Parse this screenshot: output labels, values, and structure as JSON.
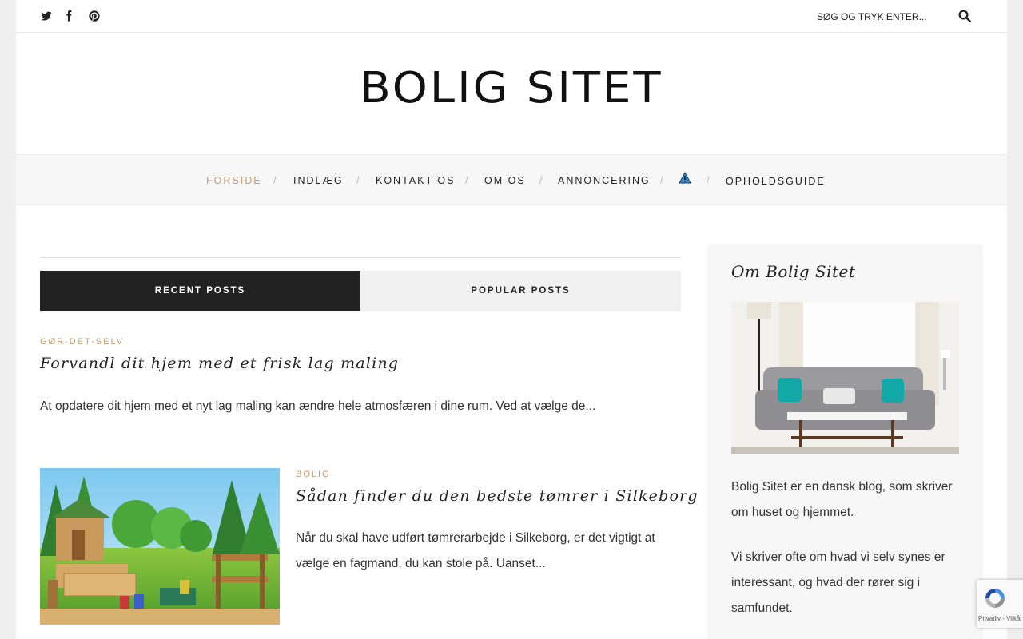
{
  "topbar": {
    "social_icons": [
      "twitter-icon",
      "facebook-icon",
      "pinterest-icon"
    ],
    "search_placeholder": "SØG OG TRYK ENTER..."
  },
  "site": {
    "logo": "BOLIG SITET"
  },
  "nav": {
    "items": [
      "FORSIDE",
      "INDLÆG",
      "KONTAKT OS",
      "OM OS",
      "ANNONCERING",
      "",
      "OPHOLDSGUIDE"
    ],
    "separator": "/",
    "active_color": "#c69c6d"
  },
  "tabs": {
    "recent": "RECENT POSTS",
    "popular": "POPULAR POSTS"
  },
  "posts": [
    {
      "category": "GØR-DET-SELV",
      "title": "Forvandl dit hjem med et frisk lag maling",
      "excerpt": "At opdatere dit hjem med et nyt lag maling kan ændre hele atmosfæren i dine rum. Ved at vælge de..."
    },
    {
      "category": "BOLIG",
      "title": "Sådan finder du den bedste tømrer i Silkeborg",
      "excerpt": "Når du skal have udført tømrerarbejde i Silkeborg, er det vigtigt at vælge en fagmand, du kan stole på. Uanset..."
    }
  ],
  "sidebar": {
    "title": "Om Bolig Sitet",
    "text1": "Bolig Sitet er en dansk blog, som skriver om huset og hjemmet.",
    "text2": "Vi skriver ofte om hvad vi selv synes er interessant, og hvad der rører sig i samfundet."
  },
  "recaptcha": {
    "links": "Privatliv - Vilkår"
  }
}
